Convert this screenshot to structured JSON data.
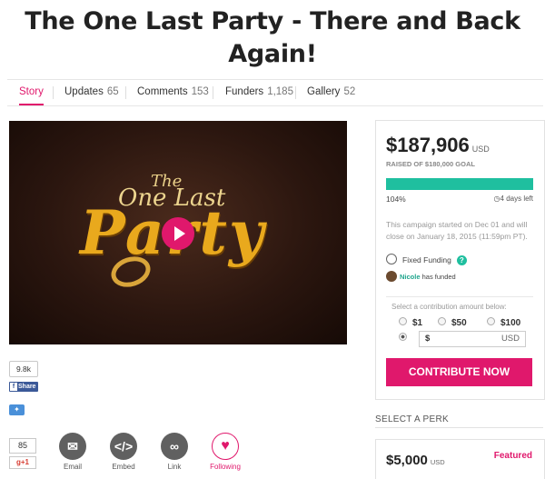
{
  "title": "The One Last Party - There and Back Again!",
  "tabs": [
    {
      "label": "Story",
      "count": ""
    },
    {
      "label": "Updates",
      "count": "65"
    },
    {
      "label": "Comments",
      "count": "153"
    },
    {
      "label": "Funders",
      "count": "1,185"
    },
    {
      "label": "Gallery",
      "count": "52"
    }
  ],
  "video": {
    "logo_the": "The",
    "logo_one_last": "One Last",
    "logo_party": "Party"
  },
  "social": {
    "fb_count": "9.8k",
    "fb_share": "Share",
    "gplus_count": "85",
    "gplus_label": "+1",
    "buttons": [
      {
        "label": "Email",
        "icon": "email-icon"
      },
      {
        "label": "Embed",
        "icon": "embed-icon"
      },
      {
        "label": "Link",
        "icon": "link-icon"
      },
      {
        "label": "Following",
        "icon": "heart-icon"
      }
    ]
  },
  "funding": {
    "raised": "$187,906",
    "currency": "USD",
    "goal_text": "RAISED OF $180,000 GOAL",
    "percent_text": "104%",
    "progress_fraction": 1.0,
    "days_number": "4",
    "days_label": "days left",
    "campaign_text": "This campaign started on Dec 01 and will close on January 18, 2015 (11:59pm PT).",
    "fixed_funding": "Fixed Funding",
    "help": "?",
    "funder_name": "Nicole",
    "funder_text": "has funded",
    "contribution_label": "Select a contribution amount below:",
    "amount_options": [
      "$1",
      "$50",
      "$100"
    ],
    "custom_prefix": "$",
    "custom_currency": "USD",
    "cta": "CONTRIBUTE NOW"
  },
  "perks": {
    "heading": "SELECT A PERK",
    "items": [
      {
        "amount": "$5,000",
        "currency": "USD",
        "badge": "Featured"
      }
    ]
  },
  "colors": {
    "accent": "#e0186c",
    "progress": "#1fbf9f"
  }
}
